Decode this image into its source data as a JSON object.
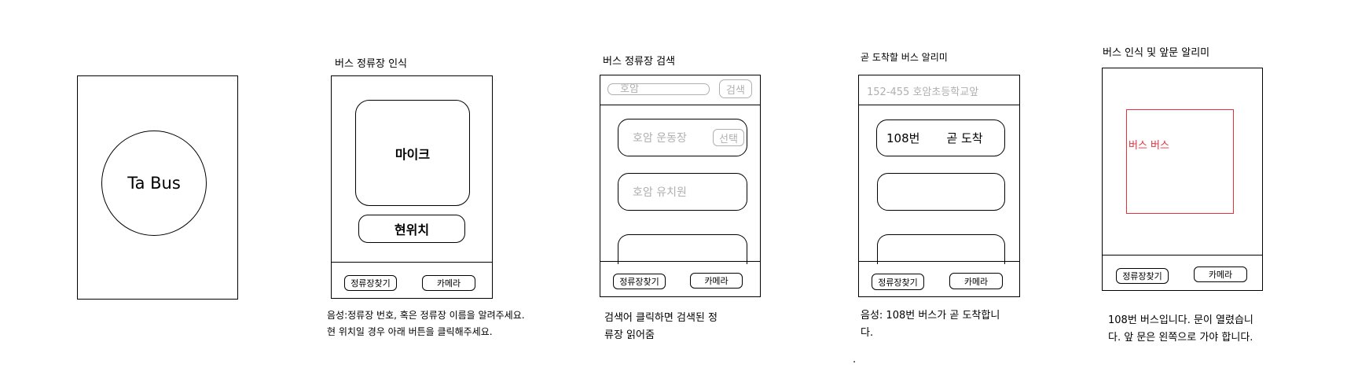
{
  "colors": {
    "line": "#000000",
    "placeholder": "#b0b0b0",
    "bus_box": "#e8303a"
  },
  "screen1": {
    "logo": "Ta Bus"
  },
  "screen2": {
    "title": "버스 정류장 인식",
    "mic_label": "마이크",
    "location_label": "현위치",
    "nav": [
      "정류장찾기",
      "카메라"
    ],
    "caption_lines": [
      "음성:정류장 번호, 혹은 정류장 이름을 알려주세요.",
      "현 위치일 경우 아래 버튼을 클릭해주세요."
    ]
  },
  "screen3": {
    "title": "버스 정류장 검색",
    "search_value": "호암",
    "search_button": "검색",
    "results": [
      "호암 운동장",
      "호암 유치원"
    ],
    "select_label": "선택",
    "nav": [
      "정류장찾기",
      "카메라"
    ],
    "caption_lines": [
      "검색어 클릭하면 검색된 정",
      "류장 읽어줌"
    ]
  },
  "screen4": {
    "title": "곧 도착할 버스 알리미",
    "stop_label": "152-455 호암초등학교앞",
    "bus_number": "108번",
    "bus_status": "곧 도착",
    "nav": [
      "정류장찾기",
      "카메라"
    ],
    "caption_lines": [
      "음성: 108번 버스가 곧 도착합니",
      "다."
    ],
    "dot": "."
  },
  "screen5": {
    "title": "버스 인식 및 앞문 알리미",
    "detected_label": "버스 버스",
    "nav": [
      "정류장찾기",
      "카메라"
    ],
    "caption_lines": [
      "108번 버스입니다.  문이 열렸습니",
      "다. 앞 문은 왼쪽으로 가야 합니다."
    ]
  }
}
